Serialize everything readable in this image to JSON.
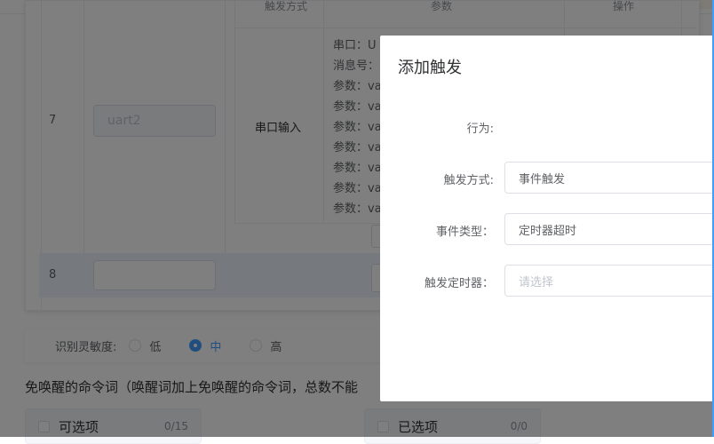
{
  "table": {
    "header": {
      "trigger_mode": "触发方式",
      "params": "参数",
      "action": "操作"
    },
    "rows": [
      {
        "index": "7",
        "name_value": "uart2",
        "trigger": "串口输入",
        "params": [
          "串口：U",
          "消息号：",
          "参数：va",
          "参数：va",
          "参数：va",
          "参数：va",
          "参数：va",
          "参数：va",
          "参数：va"
        ]
      },
      {
        "index": "8",
        "name_value": ""
      }
    ]
  },
  "sensitivity": {
    "label": "识别灵敏度:",
    "options": [
      {
        "label": "低",
        "selected": false
      },
      {
        "label": "中",
        "selected": true
      },
      {
        "label": "高",
        "selected": false
      }
    ]
  },
  "command_words_heading": "免唤醒的命令词（唤醒词加上免唤醒的命令词，总数不能",
  "transfer": {
    "left": {
      "title": "可选项",
      "count": "0/15"
    },
    "right": {
      "title": "已选项",
      "count": "0/0"
    }
  },
  "modal": {
    "title": "添加触发",
    "fields": [
      {
        "label": "行为:",
        "value": ""
      },
      {
        "label": "触发方式:",
        "value": "事件触发"
      },
      {
        "label": "事件类型：",
        "value": "定时器超时"
      },
      {
        "label": "触发定时器：",
        "value": "",
        "placeholder": "请选择"
      }
    ]
  },
  "colors": {
    "primary": "#409eff",
    "overlay": "rgba(0,0,0,0.5)"
  }
}
